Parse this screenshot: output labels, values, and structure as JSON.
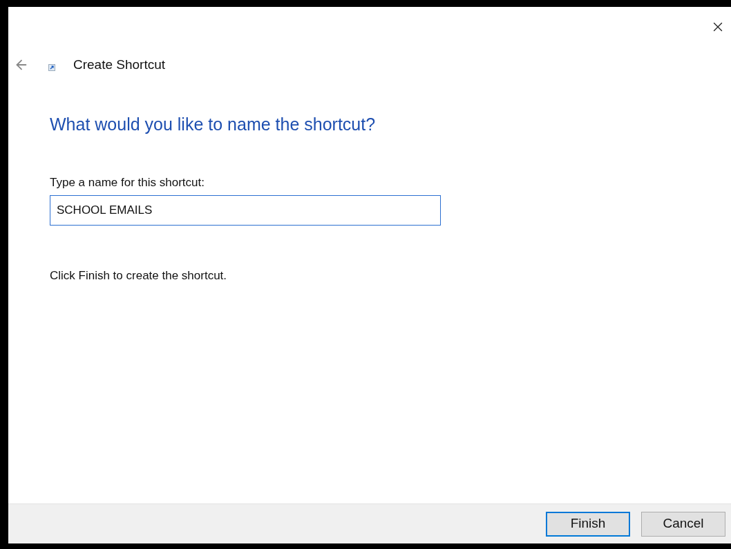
{
  "window": {
    "title": "Create Shortcut"
  },
  "heading": "What would you like to name the shortcut?",
  "name_field": {
    "label": "Type a name for this shortcut:",
    "value": "SCHOOL EMAILS"
  },
  "hint": "Click Finish to create the shortcut.",
  "buttons": [
    {
      "label": "Finish",
      "default": true
    },
    {
      "label": "Cancel",
      "default": false
    }
  ]
}
